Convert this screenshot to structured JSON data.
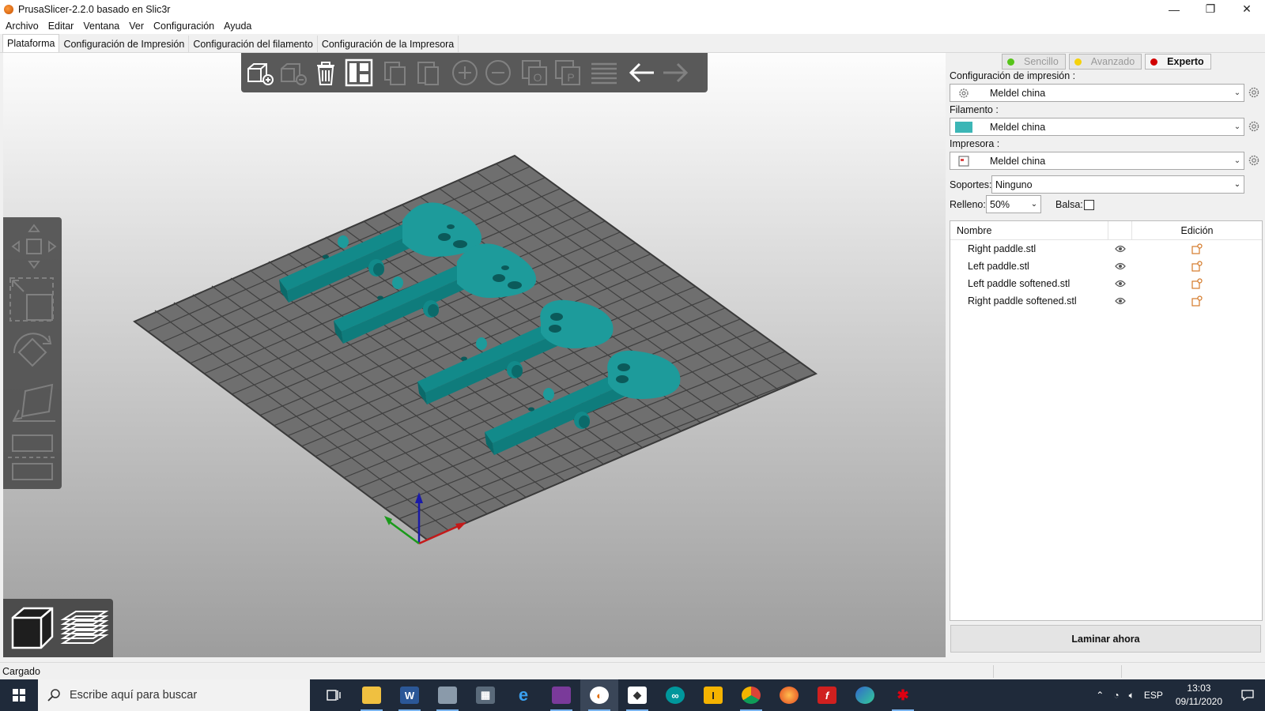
{
  "window": {
    "title": "PrusaSlicer-2.2.0 basado en Slic3r",
    "controls": {
      "minimize": "—",
      "maximize": "❐",
      "close": "✕"
    }
  },
  "menu": [
    "Archivo",
    "Editar",
    "Ventana",
    "Ver",
    "Configuración",
    "Ayuda"
  ],
  "tabs": [
    "Plataforma",
    "Configuración de Impresión",
    "Configuración del filamento",
    "Configuración de la Impresora"
  ],
  "modes": [
    {
      "label": "Sencillo",
      "color": "#57c41a"
    },
    {
      "label": "Avanzado",
      "color": "#f5d20b"
    },
    {
      "label": "Experto",
      "color": "#d10000"
    }
  ],
  "presets": {
    "print_label": "Configuración de impresión :",
    "print_value": "Meldel china",
    "filament_label": "Filamento :",
    "filament_value": "Meldel china",
    "filament_color": "#3cb6b6",
    "printer_label": "Impresora :",
    "printer_value": "Meldel china",
    "supports_label": "Soportes:",
    "supports_value": "Ninguno",
    "infill_label": "Relleno:",
    "infill_value": "50%",
    "brim_label": "Balsa:"
  },
  "objects": {
    "col_name": "Nombre",
    "col_edit": "Edición",
    "items": [
      "Right paddle.stl",
      "Left paddle.stl",
      "Left paddle softened.stl",
      "Right paddle softened.stl"
    ]
  },
  "slice_button": "Laminar ahora",
  "status": "Cargado",
  "colors": {
    "model": "#1d9b9b",
    "bed": "#6f6f6f",
    "toolbar": "#4c4c4c"
  },
  "taskbar": {
    "search_placeholder": "Escribe aquí para buscar",
    "apps": [
      "task-view",
      "file-explorer",
      "word",
      "devices",
      "calculator",
      "edge-legacy",
      "winrar",
      "prusaslicer",
      "inkscape",
      "arduino",
      "ide",
      "chrome",
      "firefox",
      "flash",
      "edge",
      "red-app"
    ],
    "lang": "ESP",
    "time": "13:03",
    "date": "09/11/2020"
  }
}
